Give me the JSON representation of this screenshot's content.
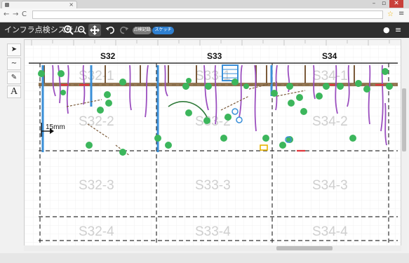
{
  "browser": {
    "tab_close": "×",
    "nav_back": "←",
    "nav_forward": "→",
    "nav_reload": "C",
    "star_icon": "☆",
    "menu_icon": "≡",
    "win_min": "–",
    "win_max": "▫",
    "win_close": "✕"
  },
  "app": {
    "title": "インフラ点検システム",
    "pill_inspection": "点検記録",
    "pill_sketch": "スケッチ"
  },
  "toolbar_icons": [
    "zoom-in-icon",
    "zoom-out-icon",
    "move-icon",
    "undo-icon",
    "redo-icon"
  ],
  "palette": {
    "select": "➤",
    "freehand": "~",
    "brush": "✎",
    "text": "A"
  },
  "canvas": {
    "column_labels": [
      "S32",
      "S33",
      "S34"
    ],
    "grid_row1": [
      "S32-1",
      "S33-1",
      "S34-1"
    ],
    "grid_row2": [
      "S32-2",
      "S33-2",
      "S34-2"
    ],
    "grid_row3": [
      "S32-3",
      "S33-3",
      "S34-3"
    ],
    "grid_row4": [
      "S32-4",
      "S33-4",
      "S34-4"
    ],
    "dimension_label": "15mm"
  },
  "colors": {
    "toolbar": "#2f2f2f",
    "accent_blue": "#2e7fd0",
    "marker_green": "#3cb65c",
    "crack_purple": "#9b4fbf",
    "rebar_brown": "#7a5a3a",
    "grid": "#e3e3e3"
  }
}
